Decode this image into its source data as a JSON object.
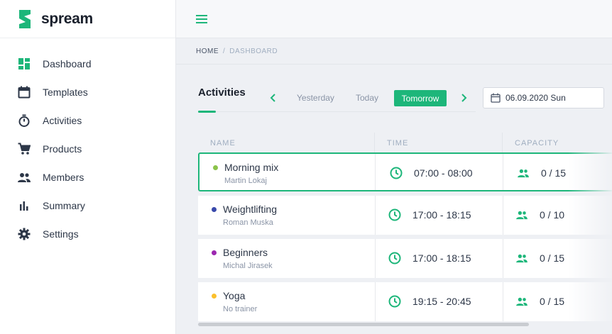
{
  "brand": {
    "name": "spream",
    "color": "#1db67a"
  },
  "sidebar": {
    "items": [
      {
        "label": "Dashboard",
        "icon": "dashboard-icon"
      },
      {
        "label": "Templates",
        "icon": "calendar-icon"
      },
      {
        "label": "Activities",
        "icon": "stopwatch-icon"
      },
      {
        "label": "Products",
        "icon": "cart-icon"
      },
      {
        "label": "Members",
        "icon": "people-icon"
      },
      {
        "label": "Summary",
        "icon": "bar-chart-icon"
      },
      {
        "label": "Settings",
        "icon": "gear-icon"
      }
    ]
  },
  "breadcrumb": {
    "home": "HOME",
    "separator": "/",
    "current": "DASHBOARD"
  },
  "activities": {
    "title": "Activities",
    "days": {
      "yesterday": "Yesterday",
      "today": "Today",
      "tomorrow": "Tomorrow",
      "selected": "Tomorrow"
    },
    "date": "06.09.2020 Sun",
    "columns": {
      "name": "NAME",
      "time": "TIME",
      "capacity": "CAPACITY"
    },
    "rows": [
      {
        "name": "Morning mix",
        "trainer": "Martin Lokaj",
        "time": "07:00 - 08:00",
        "capacity": "0 / 15",
        "dot_color": "#8bc34a",
        "selected": true
      },
      {
        "name": "Weightlifting",
        "trainer": "Roman Muska",
        "time": "17:00 - 18:15",
        "capacity": "0 / 10",
        "dot_color": "#3949ab",
        "selected": false
      },
      {
        "name": "Beginners",
        "trainer": "Michal Jirasek",
        "time": "17:00 - 18:15",
        "capacity": "0 / 15",
        "dot_color": "#9c27b0",
        "selected": false
      },
      {
        "name": "Yoga",
        "trainer": "No trainer",
        "time": "19:15 - 20:45",
        "capacity": "0 / 15",
        "dot_color": "#fbc02d",
        "selected": false
      }
    ]
  },
  "colors": {
    "accent": "#1db67a",
    "text": "#2d3748",
    "muted": "#8a94a6"
  }
}
